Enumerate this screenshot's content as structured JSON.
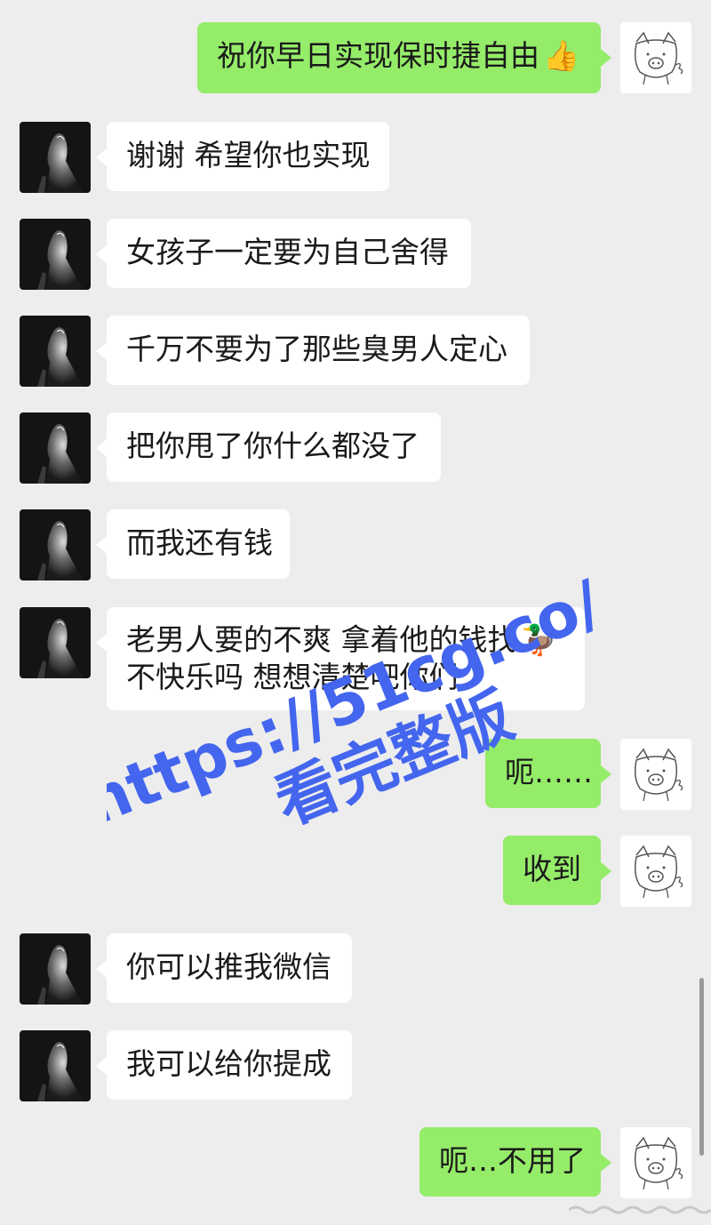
{
  "messages": [
    {
      "side": "right",
      "text": "祝你早日实现保时捷自由",
      "emoji": "👍"
    },
    {
      "side": "left",
      "text": "谢谢 希望你也实现"
    },
    {
      "side": "left",
      "text": "女孩子一定要为自己舍得"
    },
    {
      "side": "left",
      "text": "千万不要为了那些臭男人定心"
    },
    {
      "side": "left",
      "text": "把你甩了你什么都没了"
    },
    {
      "side": "left",
      "text": "而我还有钱"
    },
    {
      "side": "left",
      "line1": "老男人要的不爽 拿着他的钱找",
      "line2": "不快乐吗 想想清楚吧你们",
      "emoji": "🦆"
    },
    {
      "side": "right",
      "text": "呃……"
    },
    {
      "side": "right",
      "text": "收到"
    },
    {
      "side": "left",
      "text": "你可以推我微信"
    },
    {
      "side": "left",
      "text": "我可以给你提成"
    },
    {
      "side": "right",
      "text": "呃…不用了"
    }
  ],
  "watermark": {
    "line1": "https://51cg.co/",
    "line2": "看完整版",
    "color": "#4466ee"
  },
  "colors": {
    "background": "#ededed",
    "self_bubble": "#95ec69",
    "other_bubble": "#ffffff"
  }
}
